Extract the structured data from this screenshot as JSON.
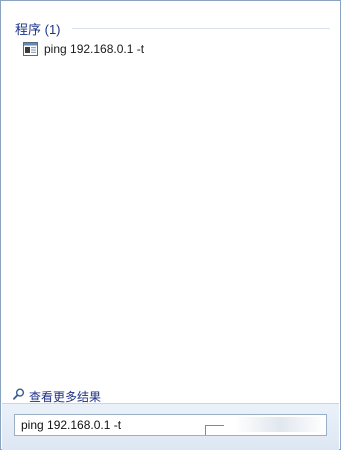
{
  "results": {
    "group_header": "程序 (1)",
    "items": [
      {
        "label": "ping 192.168.0.1 -t",
        "icon": "console-window-icon"
      }
    ]
  },
  "footer": {
    "see_more_label": "查看更多结果",
    "search_value": "ping 192.168.0.1 -t"
  },
  "colors": {
    "header_text": "#1e3287",
    "link_text": "#1e3287",
    "frame_border": "#8aa3bf"
  }
}
